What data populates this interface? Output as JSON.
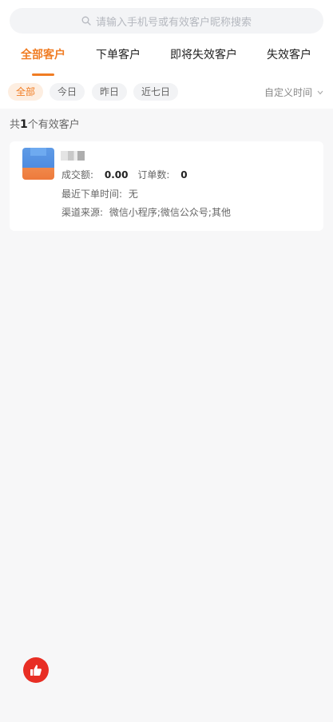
{
  "search": {
    "placeholder": "请输入手机号或有效客户昵称搜索"
  },
  "tabs": [
    {
      "label": "全部客户",
      "active": true
    },
    {
      "label": "下单客户",
      "active": false
    },
    {
      "label": "即将失效客户",
      "active": false
    },
    {
      "label": "失效客户",
      "active": false
    }
  ],
  "filters": {
    "chips": [
      {
        "label": "全部",
        "active": true
      },
      {
        "label": "今日",
        "active": false
      },
      {
        "label": "昨日",
        "active": false
      },
      {
        "label": "近七日",
        "active": false
      }
    ],
    "custom_time": "自定义时间"
  },
  "summary": {
    "prefix": "共",
    "count": "1",
    "suffix": "个有效客户"
  },
  "customers": [
    {
      "amount_label": "成交额:",
      "amount_value": "0.00",
      "orders_label": "订单数:",
      "orders_value": "0",
      "last_order_label": "最近下单时间:",
      "last_order_value": "无",
      "channel_label": "渠道来源:",
      "channel_value": "微信小程序;微信公众号;其他"
    }
  ],
  "colors": {
    "accent": "#f07c23",
    "fab": "#e82e24"
  },
  "icons": {
    "search": "search-icon",
    "dropdown": "chevron-down-icon",
    "fab": "thumbs-up-icon"
  }
}
